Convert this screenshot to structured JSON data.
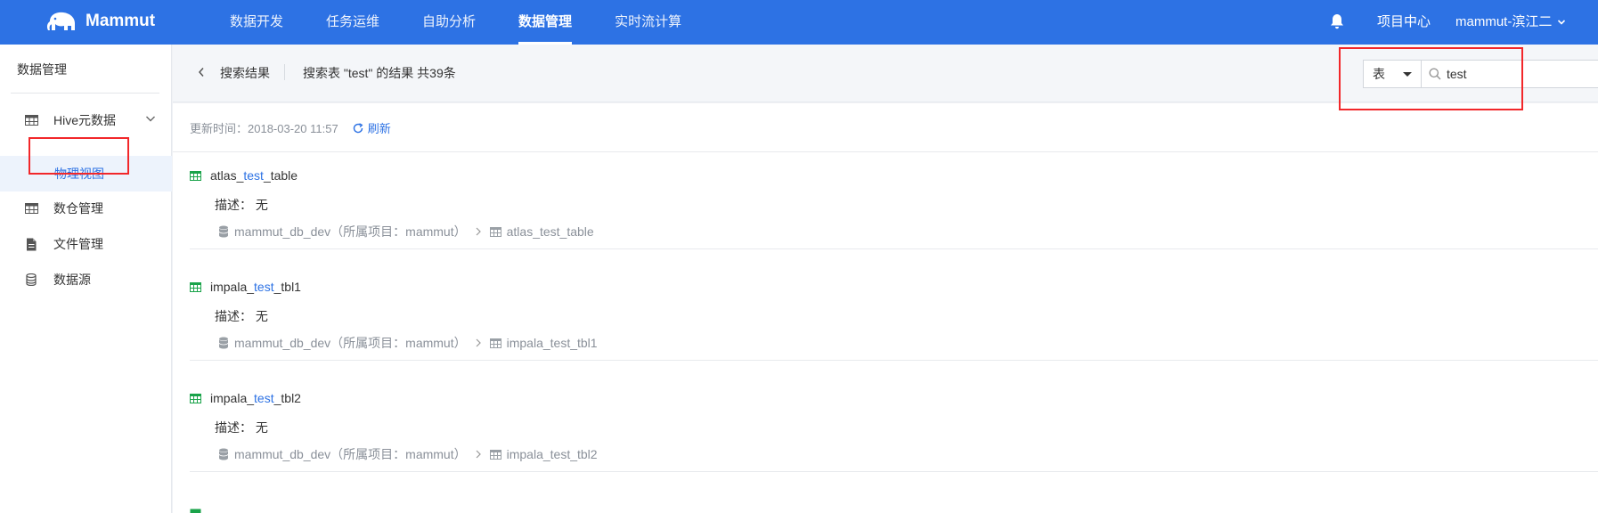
{
  "app": {
    "logo": "Mammut"
  },
  "nav": {
    "items": [
      {
        "label": "数据开发"
      },
      {
        "label": "任务运维"
      },
      {
        "label": "自助分析"
      },
      {
        "label": "数据管理",
        "active": true
      },
      {
        "label": "实时流计算"
      }
    ],
    "project_center": "项目中心",
    "user": "mammut-滨江二"
  },
  "sidebar": {
    "title": "数据管理",
    "items": [
      {
        "label": "Hive元数据",
        "icon": "table-icon"
      },
      {
        "label": "物理视图",
        "selected": true
      },
      {
        "label": "数仓管理",
        "icon": "table-icon"
      },
      {
        "label": "文件管理",
        "icon": "file-icon"
      },
      {
        "label": "数据源",
        "icon": "database-icon"
      }
    ]
  },
  "header": {
    "breadcrumb": "搜索结果",
    "result_info": "搜索表 \"test\" 的结果 共39条",
    "search": {
      "type": "表",
      "value": "test"
    }
  },
  "panel": {
    "update_time": "更新时间：2018-03-20 11:57",
    "refresh_label": "刷新"
  },
  "results": [
    {
      "prefix": "atlas_",
      "keyword": "test",
      "suffix": "_table",
      "desc": "描述： 无",
      "db": "mammut_db_dev（所属项目：mammut）",
      "table": "atlas_test_table"
    },
    {
      "prefix": "impala_",
      "keyword": "test",
      "suffix": "_tbl1",
      "desc": "描述： 无",
      "db": "mammut_db_dev（所属项目：mammut）",
      "table": "impala_test_tbl1"
    },
    {
      "prefix": "impala_",
      "keyword": "test",
      "suffix": "_tbl2",
      "desc": "描述： 无",
      "db": "mammut_db_dev（所属项目：mammut）",
      "table": "impala_test_tbl2"
    }
  ],
  "colors": {
    "primary": "#2d72e4",
    "annotation": "#f2272a",
    "table_icon": "#1aa34a"
  }
}
